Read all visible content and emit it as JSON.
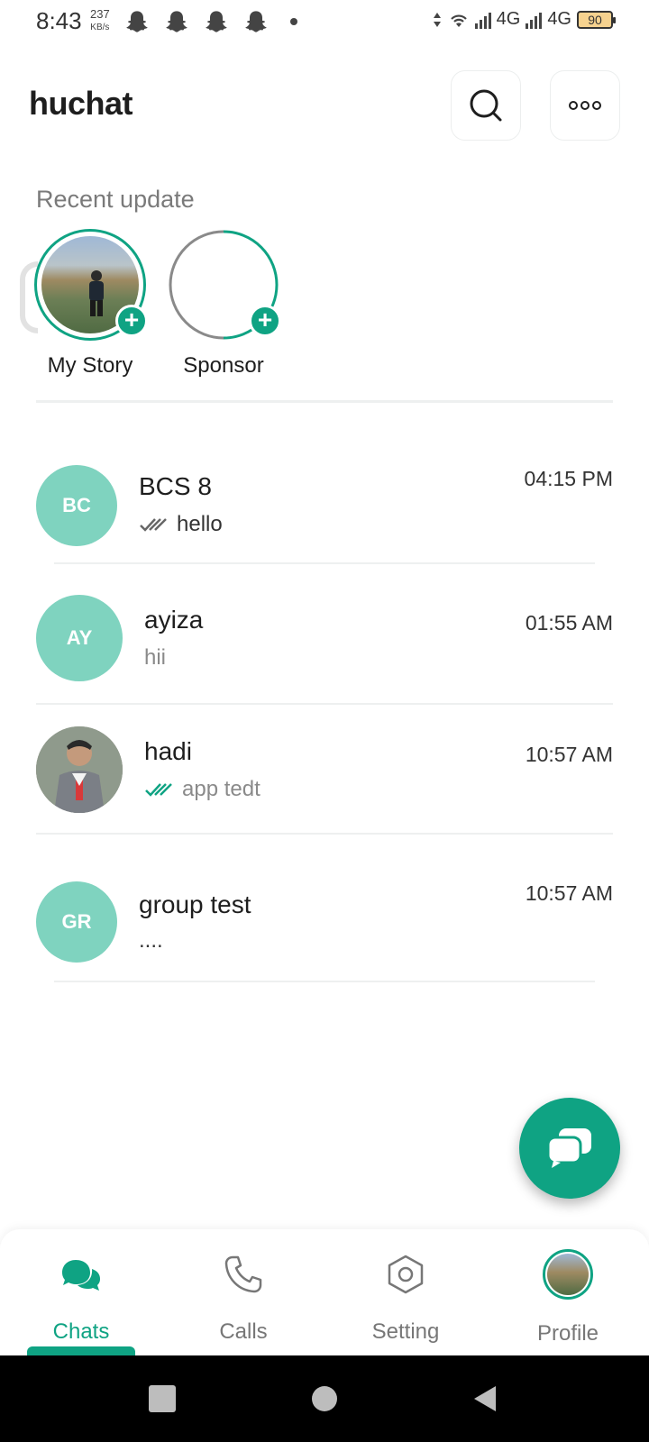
{
  "status_bar": {
    "time": "8:43",
    "speed_value": "237",
    "speed_unit": "KB/s",
    "network_1": "4G",
    "network_2": "4G",
    "battery": "90"
  },
  "header": {
    "title": "huchat",
    "search_icon": "search-icon",
    "more_icon": "more-horizontal-icon"
  },
  "recent": {
    "label": "Recent update",
    "stories": [
      {
        "name": "My Story"
      },
      {
        "name": "Sponsor"
      }
    ]
  },
  "chats": [
    {
      "initials": "BC",
      "name": "BCS 8",
      "message": "hello",
      "time": "04:15 PM",
      "ticks": "read-gray"
    },
    {
      "initials": "AY",
      "name": "ayiza",
      "message": "hii",
      "time": "01:55 AM",
      "ticks": "none"
    },
    {
      "initials": "",
      "name": "hadi",
      "message": "app tedt",
      "time": "10:57 AM",
      "ticks": "read-green"
    },
    {
      "initials": "GR",
      "name": "group test",
      "message": "....",
      "time": "10:57 AM",
      "ticks": "none"
    }
  ],
  "fab": {
    "icon": "new-chat-icon"
  },
  "bottom_nav": {
    "items": [
      {
        "label": "Chats",
        "active": true
      },
      {
        "label": "Calls",
        "active": false
      },
      {
        "label": "Setting",
        "active": false
      },
      {
        "label": "Profile",
        "active": false
      }
    ]
  },
  "colors": {
    "accent": "#0fa383",
    "avatar_bg": "#7fd3bf"
  }
}
